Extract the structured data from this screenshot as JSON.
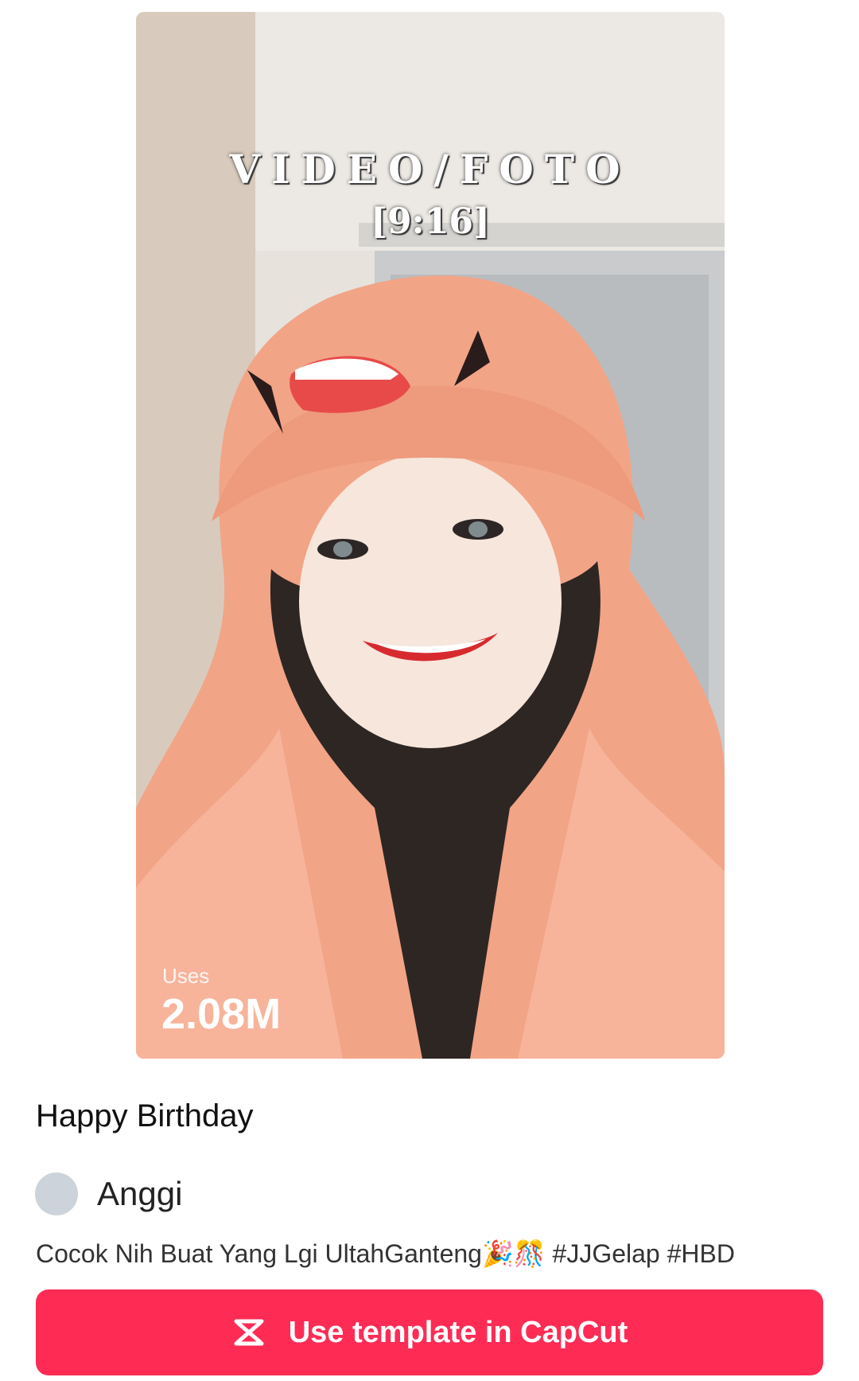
{
  "preview": {
    "overlay_title": "VIDEO/FOTO",
    "overlay_ratio": "[9:16]",
    "uses_label": "Uses",
    "uses_value": "2.08M"
  },
  "template": {
    "title": "Happy Birthday",
    "author": "Anggi",
    "description": "Cocok Nih Buat Yang Lgi UltahGanteng🎉🎊 #JJGelap #HBD"
  },
  "cta": {
    "label": "Use template in CapCut",
    "icon": "capcut-logo-icon",
    "color": "#fe2c55"
  }
}
